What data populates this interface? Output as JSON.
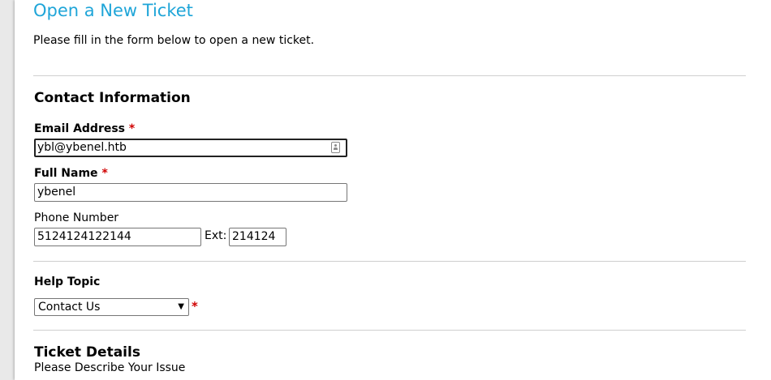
{
  "page": {
    "title": "Open a New Ticket",
    "intro": "Please fill in the form below to open a new ticket."
  },
  "contact": {
    "section_title": "Contact Information",
    "email_label": "Email Address",
    "email_value": "ybl@ybenel.htb",
    "fullname_label": "Full Name",
    "fullname_value": "ybenel",
    "phone_label": "Phone Number",
    "phone_value": "5124124122144",
    "ext_label": "Ext:",
    "ext_value": "214124",
    "required_mark": "*"
  },
  "help": {
    "label": "Help Topic",
    "selected": "Contact Us",
    "required_mark": "*"
  },
  "details": {
    "section_title": "Ticket Details",
    "describe_label": "Please Describe Your Issue"
  },
  "colors": {
    "title": "#1fa5d8",
    "required": "#d00000",
    "divider": "#cfcfcf"
  },
  "icons": {
    "email_field": "contact-card-icon",
    "select": "chevron-down-icon"
  }
}
